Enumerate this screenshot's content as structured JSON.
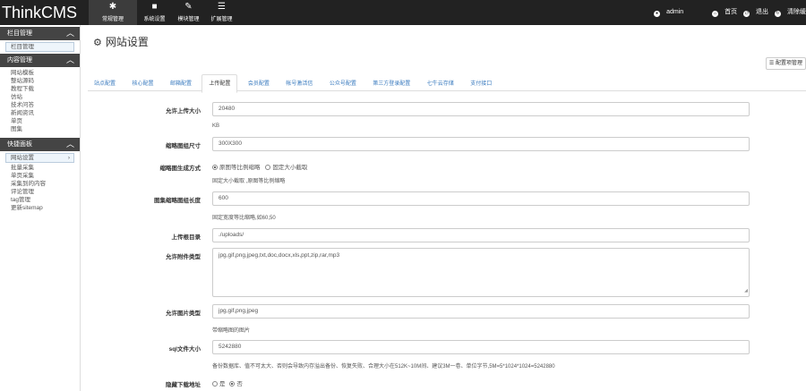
{
  "app": {
    "logo": "ThinkCMS"
  },
  "topnav": [
    {
      "icon": "✱",
      "label": "常规管理",
      "active": true
    },
    {
      "icon": "■",
      "label": "系统设置"
    },
    {
      "icon": "✎",
      "label": "模块管理"
    },
    {
      "icon": "☰",
      "label": "扩展管理"
    }
  ],
  "topright": {
    "user": "admin",
    "home": "首页",
    "logout": "退出",
    "clear": "清除缓"
  },
  "sidebar": {
    "sections": [
      {
        "title": "栏目管理",
        "items": [
          {
            "label": "栏目管理",
            "active": false
          }
        ]
      },
      {
        "title": "内容管理",
        "items": [
          {
            "label": "网站模板"
          },
          {
            "label": "整站源码"
          },
          {
            "label": "教程下载"
          },
          {
            "label": "仿站"
          },
          {
            "label": "技术问答"
          },
          {
            "label": "新闻资讯"
          },
          {
            "label": "单页"
          },
          {
            "label": "图集"
          }
        ]
      },
      {
        "title": "快捷面板",
        "items": [
          {
            "label": "网站设置",
            "active": true
          },
          {
            "label": "批量采集"
          },
          {
            "label": "单页采集"
          },
          {
            "label": "采集到的内容"
          },
          {
            "label": "评论管理"
          },
          {
            "label": "tag管理"
          },
          {
            "label": "更新sitemap"
          }
        ]
      }
    ]
  },
  "page": {
    "title": "网站设置",
    "config_button": "配置项管理"
  },
  "tabs": [
    "站点配置",
    "核心配置",
    "邮箱配置",
    "上传配置",
    "会员配置",
    "帐号激活信",
    "公众号配置",
    "第三方登录配置",
    "七牛云存储",
    "支付接口"
  ],
  "active_tab": "上传配置",
  "form": {
    "upload_size": {
      "label": "允许上传大小",
      "value": "20480",
      "help": "KB"
    },
    "thumb_size": {
      "label": "缩略图组尺寸",
      "value": "300X300"
    },
    "thumb_mode": {
      "label": "缩略图生成方式",
      "opt1": "原图等比例缩略",
      "opt2": "固定大小截取",
      "help": "固定大小截取 ,原图等比例缩略"
    },
    "thumb_len": {
      "label": "图集缩略图组长度",
      "value": "600",
      "help": "固定宽度等比缩略,如60,50"
    },
    "upload_dir": {
      "label": "上传根目录",
      "value": "./uploads/"
    },
    "attach_types": {
      "label": "允许附件类型",
      "value": "jpg,gif,png,jpeg,txt,doc,docx,xls,ppt,zip,rar,mp3"
    },
    "image_types": {
      "label": "允许图片类型",
      "value": "jpg,gif,png,jpeg",
      "help": "带缩略图的图片"
    },
    "sql_size": {
      "label": "sql文件大小",
      "value": "5242880",
      "help": "备份数据库、值不可太大、否则会导致内存溢出备份、恢复失败、合理大小在512K~10M间、建议3M一卷、单位字节,5M=5*1024*1024=5242880"
    },
    "hide_download": {
      "label": "隐藏下载地址",
      "yes": "是",
      "no": "否"
    }
  }
}
